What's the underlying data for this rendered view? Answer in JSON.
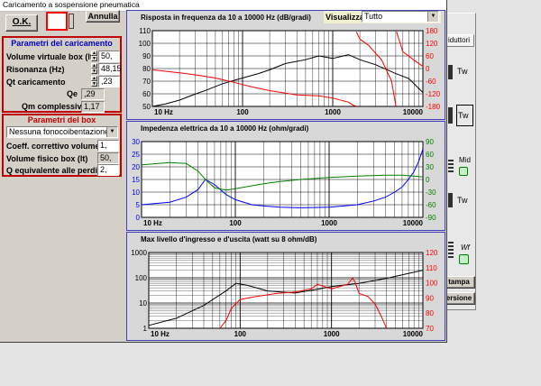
{
  "window": {
    "title": "Caricamento a sospensione pneumatica"
  },
  "buttons": {
    "ok": "O.K.",
    "annulla": "Annulla"
  },
  "params": {
    "title": "Parametri del caricamento",
    "fields": [
      {
        "label": "Volume virtuale box (lt)",
        "value": "50,"
      },
      {
        "label": "Risonanza (Hz)",
        "value": "48,15"
      },
      {
        "label": "Qt caricamento",
        "value": ",23"
      }
    ],
    "qe": {
      "label": "Qe",
      "value": ",29"
    },
    "qm": {
      "label": "Qm complessivo",
      "value": "1,17"
    }
  },
  "box": {
    "title": "Parametri del box",
    "select_value": "Nessuna fonocoibentazione",
    "fields": [
      {
        "label": "Coeff. correttivo volume",
        "value": "1,"
      },
      {
        "label": "Volume fisico box (lt)",
        "value": "50,"
      },
      {
        "label": "Q equivalente alle perdite",
        "value": "2,"
      }
    ]
  },
  "visualizza": {
    "label": "Visualizza",
    "value": "Tutto"
  },
  "right_panel": {
    "tab": "iduttori",
    "drivers": [
      "Tw",
      "Tw",
      "Mid",
      "Tw",
      "Wf"
    ],
    "stampa": "tampa",
    "versione": "ersione"
  },
  "chart_data": [
    {
      "type": "line",
      "title": "Risposta in frequenza da 10 a 10000 Hz (dB/gradi)",
      "xscale": "log",
      "xlim": [
        10,
        10000
      ],
      "xticks": [
        "10 Hz",
        "100",
        "1000",
        "10000"
      ],
      "ylim": [
        50,
        110
      ],
      "yticks": [
        50,
        60,
        70,
        80,
        90,
        100,
        110
      ],
      "y2lim": [
        -180,
        180
      ],
      "y2ticks": [
        -180,
        -120,
        -60,
        0,
        60,
        120,
        180
      ],
      "series": [
        {
          "axis": "left",
          "color": "#000000",
          "x": [
            10,
            14,
            20,
            28,
            40,
            60,
            100,
            150,
            200,
            300,
            500,
            700,
            1000,
            1500,
            2000,
            3000,
            5000,
            7000,
            10000
          ],
          "y": [
            50,
            52,
            55,
            59,
            63,
            68,
            72.5,
            76,
            79,
            84,
            87,
            90,
            88,
            91,
            87,
            83,
            76,
            72,
            61
          ]
        },
        {
          "axis": "right",
          "color": "#ff0000",
          "x": [
            10,
            20,
            30,
            50,
            80,
            120,
            200,
            400,
            700,
            1000,
            1500,
            1700,
            1800,
            1830,
            2000,
            2500,
            3500,
            4500,
            5000,
            5100,
            6000,
            8000,
            10000
          ],
          "y": [
            -6,
            -20,
            -30,
            -45,
            -65,
            -85,
            -105,
            -125,
            -130,
            -140,
            -160,
            -175,
            -178,
            175,
            140,
            110,
            40,
            -60,
            -175,
            175,
            80,
            40,
            10
          ]
        }
      ]
    },
    {
      "type": "line",
      "title": "Impedenza elettrica da 10 a 10000 Hz (ohm/gradi)",
      "xscale": "log",
      "xlim": [
        10,
        10000
      ],
      "xticks": [
        "10 Hz",
        "100",
        "1000",
        "10000"
      ],
      "ylim": [
        0,
        30
      ],
      "yticks": [
        0,
        5,
        10,
        15,
        20,
        25,
        30
      ],
      "y2lim": [
        -90,
        90
      ],
      "y2ticks": [
        -90,
        -60,
        -30,
        0,
        30,
        60,
        90
      ],
      "series": [
        {
          "axis": "left",
          "color": "#0000ff",
          "x": [
            10,
            20,
            30,
            40,
            48,
            60,
            80,
            100,
            150,
            200,
            300,
            500,
            1000,
            2000,
            3000,
            4000,
            5000,
            6000,
            7000,
            8000,
            9000,
            10000
          ],
          "y": [
            5,
            6,
            8,
            11,
            15,
            13,
            9,
            7,
            5,
            4.5,
            4,
            3.8,
            4,
            5,
            6.5,
            8,
            10,
            12,
            15,
            18,
            22,
            27
          ]
        },
        {
          "axis": "right",
          "color": "#008000",
          "x": [
            10,
            20,
            30,
            40,
            48,
            60,
            80,
            100,
            150,
            200,
            300,
            500,
            1000,
            2000,
            4000,
            6000,
            8000,
            10000
          ],
          "y": [
            35,
            40,
            38,
            20,
            0,
            -20,
            -25,
            -22,
            -15,
            -10,
            -5,
            0,
            5,
            8,
            10,
            10,
            8,
            6
          ]
        }
      ]
    },
    {
      "type": "line",
      "title": "Max livello d'ingresso e d'uscita (watt su 8 ohm/dB)",
      "xscale": "log",
      "xlim": [
        10,
        10000
      ],
      "xticks": [
        "10 Hz",
        "100",
        "1000",
        "10000"
      ],
      "yscale": "log",
      "ylim": [
        1,
        1000
      ],
      "yticks": [
        1,
        10,
        100,
        1000
      ],
      "y2lim": [
        70,
        120
      ],
      "y2ticks": [
        70,
        80,
        90,
        100,
        110,
        120
      ],
      "series": [
        {
          "axis": "left",
          "color": "#000000",
          "x": [
            10,
            20,
            40,
            70,
            90,
            120,
            200,
            400,
            700,
            1000,
            2000,
            4000,
            7000,
            10000
          ],
          "y": [
            1.3,
            2.5,
            8,
            30,
            60,
            50,
            30,
            25,
            35,
            45,
            60,
            95,
            150,
            200
          ]
        },
        {
          "axis": "right",
          "color": "#ff0000",
          "x": [
            60,
            70,
            80,
            100,
            150,
            250,
            400,
            600,
            700,
            800,
            1000,
            1500,
            1700,
            1800,
            2000,
            2500,
            3000,
            3500,
            4000
          ],
          "y": [
            70,
            75,
            83,
            89,
            91,
            93,
            94,
            96,
            99,
            98,
            96,
            99,
            103,
            101,
            93,
            91,
            86,
            78,
            70
          ]
        }
      ]
    }
  ]
}
